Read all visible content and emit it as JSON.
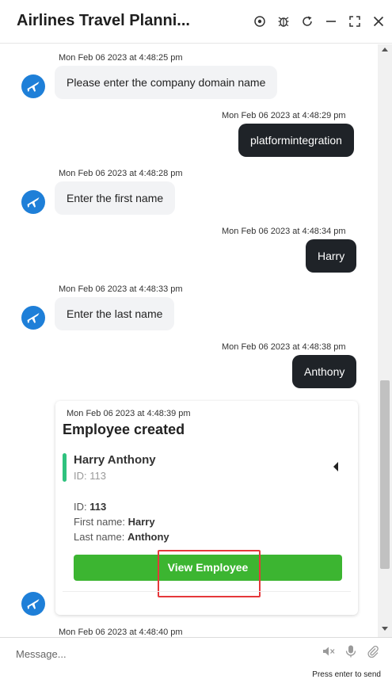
{
  "header": {
    "title": "Airlines Travel Planni...",
    "icons": [
      "target-icon",
      "bug-icon",
      "refresh-icon",
      "minimize-icon",
      "fullscreen-icon",
      "close-icon"
    ]
  },
  "messages": [
    {
      "from": "bot",
      "time": "Mon Feb 06 2023 at 4:48:25 pm",
      "text": "Please enter the company domain name"
    },
    {
      "from": "user",
      "time": "Mon Feb 06 2023 at 4:48:29 pm",
      "text": "platformintegration"
    },
    {
      "from": "bot",
      "time": "Mon Feb 06 2023 at 4:48:28 pm",
      "text": "Enter the first name"
    },
    {
      "from": "user",
      "time": "Mon Feb 06 2023 at 4:48:34 pm",
      "text": "Harry"
    },
    {
      "from": "bot",
      "time": "Mon Feb 06 2023 at 4:48:33 pm",
      "text": "Enter the last name"
    },
    {
      "from": "user",
      "time": "Mon Feb 06 2023 at 4:48:38 pm",
      "text": "Anthony"
    }
  ],
  "card": {
    "time": "Mon Feb 06 2023 at 4:48:39 pm",
    "title": "Employee created",
    "employee_name": "Harry Anthony",
    "employee_id_line": "ID: 113",
    "id_label": "ID: ",
    "id_value": "113",
    "first_name_label": "First name: ",
    "first_name_value": "Harry",
    "last_name_label": "Last name: ",
    "last_name_value": "Anthony",
    "button_label": "View Employee"
  },
  "next_time": "Mon Feb 06 2023 at 4:48:40 pm",
  "composer": {
    "placeholder": "Message...",
    "hint": "Press enter to send"
  },
  "colors": {
    "user_bubble": "#1f2328",
    "bot_bubble": "#f2f3f5",
    "avatar": "#1e7fd8",
    "button": "#3cb531",
    "accent": "#2ec27e",
    "highlight": "#e5383b"
  }
}
